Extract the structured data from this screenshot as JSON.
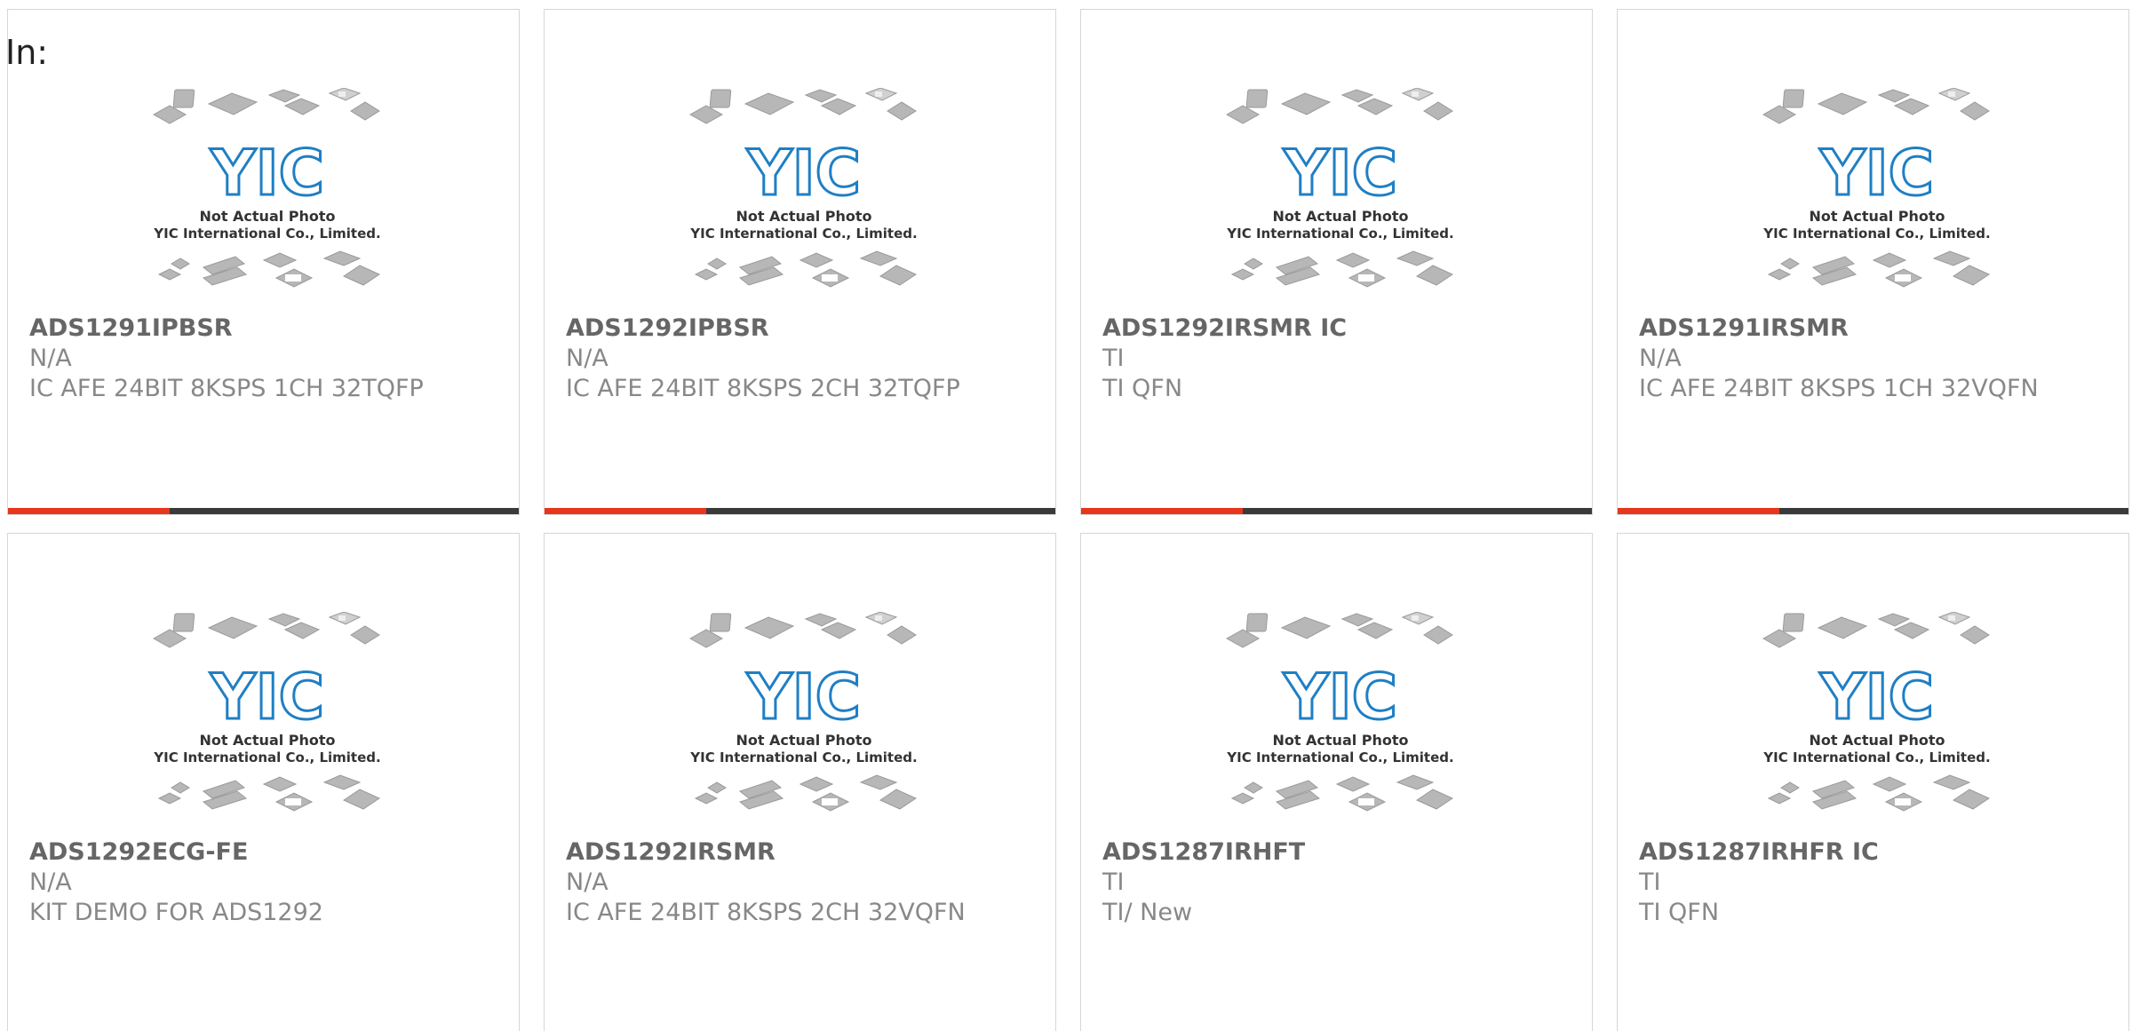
{
  "header": {
    "label": "In:"
  },
  "placeholder": {
    "logo_text": "YIC",
    "line1": "Not Actual Photo",
    "line2": "YIC International Co., Limited."
  },
  "colors": {
    "accent": "#e6361b",
    "bar": "#3a3a3a",
    "logo": "#1f7fc4"
  },
  "products": [
    {
      "part_number": "ADS1291IPBSR",
      "manufacturer": "N/A",
      "description": "IC AFE 24BIT 8KSPS 1CH 32TQFP"
    },
    {
      "part_number": "ADS1292IPBSR",
      "manufacturer": "N/A",
      "description": "IC AFE 24BIT 8KSPS 2CH 32TQFP"
    },
    {
      "part_number": "ADS1292IRSMR IC",
      "manufacturer": "TI",
      "description": "TI QFN"
    },
    {
      "part_number": "ADS1291IRSMR",
      "manufacturer": "N/A",
      "description": "IC AFE 24BIT 8KSPS 1CH 32VQFN"
    },
    {
      "part_number": "ADS1292ECG-FE",
      "manufacturer": "N/A",
      "description": "KIT DEMO FOR ADS1292"
    },
    {
      "part_number": "ADS1292IRSMR",
      "manufacturer": "N/A",
      "description": "IC AFE 24BIT 8KSPS 2CH 32VQFN"
    },
    {
      "part_number": "ADS1287IRHFT",
      "manufacturer": "TI",
      "description": "TI/ New"
    },
    {
      "part_number": "ADS1287IRHFR IC",
      "manufacturer": "TI",
      "description": "TI QFN"
    }
  ]
}
